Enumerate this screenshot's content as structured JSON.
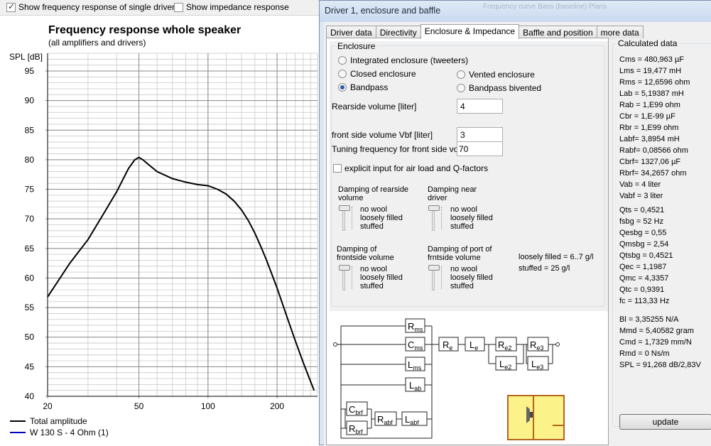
{
  "topbar": {
    "show_single_driver": "Show frequency response of single driver",
    "show_impedance": "Show impedance response"
  },
  "chart_data": {
    "type": "line",
    "title": "Frequency response whole speaker",
    "subtitle": "(all amplifiers and drivers)",
    "ylabel": "SPL [dB]",
    "xlabel": "",
    "x_scale": "log",
    "xlim": [
      20,
      300
    ],
    "ylim": [
      40,
      98
    ],
    "x_ticks": [
      "20",
      "50",
      "100",
      "200"
    ],
    "y_ticks": [
      "95",
      "90",
      "85",
      "80",
      "75",
      "70",
      "65",
      "60",
      "55",
      "50",
      "45",
      "40"
    ],
    "grid": true,
    "series": [
      {
        "name": "Total amplitude",
        "color": "#000000",
        "x": [
          20,
          25,
          30,
          35,
          40,
          45,
          48,
          50,
          52,
          55,
          60,
          70,
          80,
          90,
          100,
          110,
          120,
          130,
          140,
          150,
          160,
          170,
          180,
          190,
          200,
          220,
          240,
          260,
          280,
          290,
          300
        ],
        "y": [
          56.8,
          62.5,
          66.5,
          70.8,
          74.6,
          78.5,
          80.0,
          80.4,
          80.0,
          79.2,
          78.0,
          76.8,
          76.2,
          75.8,
          75.6,
          75.0,
          74.2,
          73.0,
          71.5,
          69.7,
          67.6,
          65.3,
          63.0,
          60.6,
          58.3,
          53.6,
          49.4,
          45.7,
          42.5,
          41.0,
          39.8
        ]
      },
      {
        "name": "W 130 S - 4 Ohm (1)",
        "color": "#0000c0",
        "x": [],
        "y": []
      }
    ]
  },
  "dialog": {
    "title": "Driver 1, enclosure and baffle",
    "ghost_title": "Frequency curve         Bass (baseline) Plans",
    "tabs": [
      {
        "label": "Driver data",
        "active": false
      },
      {
        "label": "Directivity",
        "active": false
      },
      {
        "label": "Enclosure & Impedance",
        "active": true
      },
      {
        "label": "Baffle and position",
        "active": false
      },
      {
        "label": "more data",
        "active": false
      }
    ],
    "enclosure": {
      "label": "Enclosure",
      "options": [
        {
          "label": "Integrated enclosure (tweeters)",
          "selected": false
        },
        {
          "label": "Closed enclosure",
          "selected": false
        },
        {
          "label": "Vented enclosure",
          "selected": false
        },
        {
          "label": "Bandpass",
          "selected": true
        },
        {
          "label": "Bandpass bivented",
          "selected": false
        }
      ],
      "rearside_volume_label": "Rearside volume [liter]",
      "rearside_volume": "4",
      "front_volume_label": "front side volume Vbf [liter]",
      "front_volume": "3",
      "tuning_label": "Tuning frequency for front side volume",
      "tuning_value": "70",
      "explicit_label": "explicit input for air load and Q-factors",
      "damping": [
        {
          "title": "Damping of rearside volume",
          "level": 0
        },
        {
          "title": "Damping near driver",
          "level": 0
        },
        {
          "title": "Damping of frontside volume",
          "level": 0
        },
        {
          "title": "Damping of port of frntside volume",
          "level": 0
        }
      ],
      "damping_options": [
        "no wool",
        "loosely filled",
        "stuffed"
      ],
      "density_loose": "loosely filled = 6..7 g/l",
      "density_stuffed": "stuffed = 25 g/l"
    },
    "circuit": {
      "rms": "R",
      "rms_sub": "ms",
      "cms": "C",
      "cms_sub": "ms",
      "lms": "L",
      "lms_sub": "ms",
      "lab": "L",
      "lab_sub": "ab",
      "re": "R",
      "re_sub": "e",
      "le": "L",
      "le_sub": "e",
      "re2": "R",
      "re2_sub": "e2",
      "le2": "L",
      "le2_sub": "e2",
      "re3": "R",
      "re3_sub": "e3",
      "le3": "L",
      "le3_sub": "e3",
      "cbrf": "C",
      "cbrf_sub": "brf",
      "rbrf": "R",
      "rbrf_sub": "brf",
      "rabf": "R",
      "rabf_sub": "abf",
      "labf": "L",
      "labf_sub": "abf"
    },
    "calculated": {
      "label": "Calculated data",
      "group1": [
        "Cms = 480,963 µF",
        "Lms = 19,477 mH",
        "Rms = 12,6596 ohm",
        "Lab = 5,19387 mH",
        "Rab = 1,E99 ohm",
        "Cbr = 1,E-99 µF",
        "Rbr = 1,E99 ohm",
        "Labf= 3,8954 mH",
        "Rabf= 0,08566 ohm",
        "Cbrf= 1327,06 µF",
        "Rbrf= 34,2657 ohm",
        "Vab = 4 liter",
        "Vabf = 3 liter"
      ],
      "group2": [
        "Qts = 0,4521",
        "fsbg = 52 Hz",
        "Qesbg = 0,55",
        "Qmsbg = 2,54",
        "Qtsbg = 0,4521",
        "Qec = 1,1987",
        "Qmc = 4,3357",
        "Qtc = 0,9391",
        "fc = 113,33 Hz"
      ],
      "group3": [
        "Bl = 3,35255 N/A",
        "Mmd = 5,40582 gram",
        "Cmd = 1,7329 mm/N",
        "Rmd = 0 Ns/m",
        "SPL = 91,268 dB/2,83V"
      ]
    },
    "update_label": "update"
  }
}
